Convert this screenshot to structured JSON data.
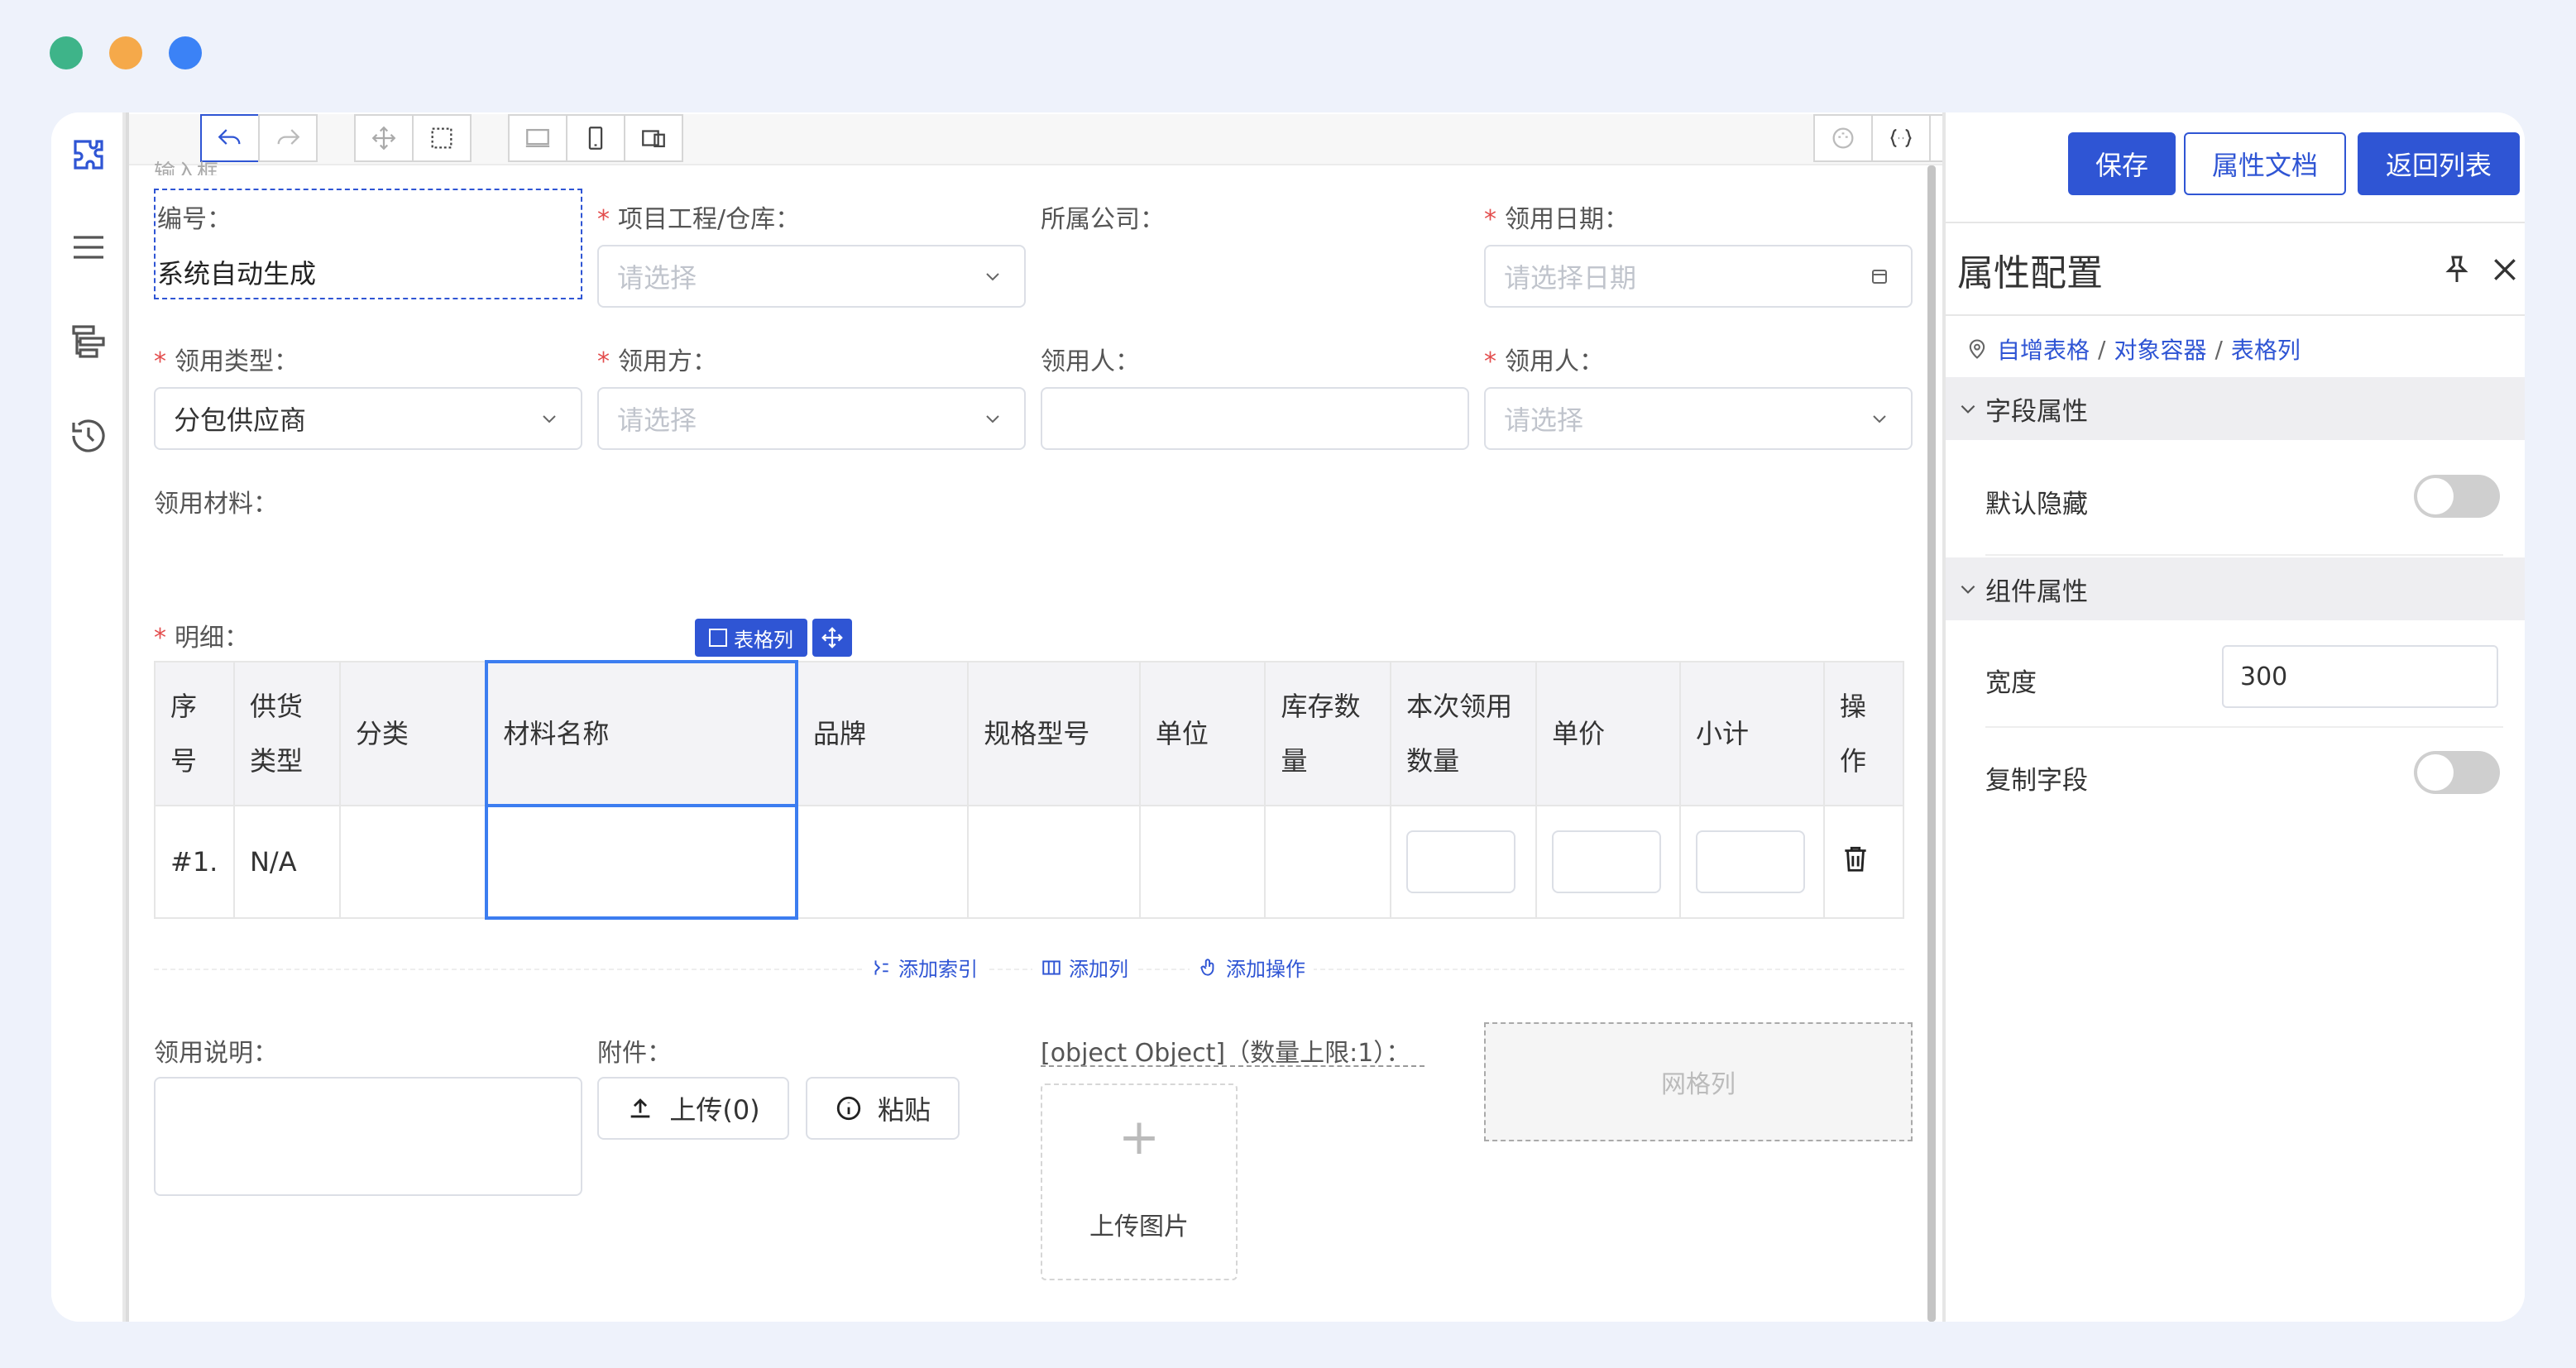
{
  "window_controls": {
    "colors": [
      "#3eb489",
      "#f5a94a",
      "#3b82f6"
    ]
  },
  "icons": {
    "rail": [
      "puzzle-icon",
      "menu-icon",
      "tree-icon",
      "history-icon"
    ],
    "toolbar": [
      "undo-icon",
      "redo-icon",
      "move-icon",
      "select-box-icon",
      "desktop-icon",
      "mobile-icon",
      "tablet-icon",
      "palette-icon",
      "code-icon",
      "play-icon"
    ]
  },
  "form": {
    "partial_top_label": "输入框",
    "number": {
      "label": "编号：",
      "value": "系统自动生成"
    },
    "project": {
      "label": "项目工程/仓库：",
      "placeholder": "请选择"
    },
    "company": {
      "label": "所属公司："
    },
    "date": {
      "label": "领用日期：",
      "placeholder": "请选择日期"
    },
    "type": {
      "label": "领用类型：",
      "value": "分包供应商"
    },
    "party": {
      "label": "领用方：",
      "placeholder": "请选择"
    },
    "person1": {
      "label": "领用人："
    },
    "person2": {
      "label": "领用人：",
      "placeholder": "请选择"
    },
    "materials": {
      "label": "领用材料："
    },
    "detail": {
      "label": "明细：",
      "chip": "表格列"
    },
    "table": {
      "headers": [
        [
          "序",
          "号"
        ],
        [
          "供货",
          "类型"
        ],
        [
          "分类"
        ],
        [
          "材料名称"
        ],
        [
          "品牌"
        ],
        [
          "规格型号"
        ],
        [
          "单位"
        ],
        [
          "库存数",
          "量"
        ],
        [
          "本次领用",
          "数量"
        ],
        [
          "单价"
        ],
        [
          "小计"
        ],
        [
          "操",
          "作"
        ]
      ],
      "rows": [
        {
          "index": "#1.",
          "supply_type": "N/A"
        }
      ]
    },
    "table_actions": [
      "添加索引",
      "添加列",
      "添加操作"
    ],
    "note": {
      "label": "领用说明："
    },
    "attach": {
      "label": "附件：",
      "upload": "上传(0)",
      "paste": "粘贴"
    },
    "image": {
      "label": "[object Object]（数量上限:1）：",
      "upload": "上传图片"
    },
    "grid": {
      "label": "网格列"
    }
  },
  "panel": {
    "buttons": {
      "save": "保存",
      "docs": "属性文档",
      "back": "返回列表"
    },
    "title": "属性配置",
    "breadcrumb": [
      "自增表格",
      "对象容器",
      "表格列"
    ],
    "sections": {
      "field": "字段属性",
      "component": "组件属性"
    },
    "default_hidden": {
      "label": "默认隐藏",
      "on": false
    },
    "width": {
      "label": "宽度",
      "value": "300"
    },
    "copy_field": {
      "label": "复制字段",
      "on": false
    },
    "accent": "#2f55d4"
  }
}
